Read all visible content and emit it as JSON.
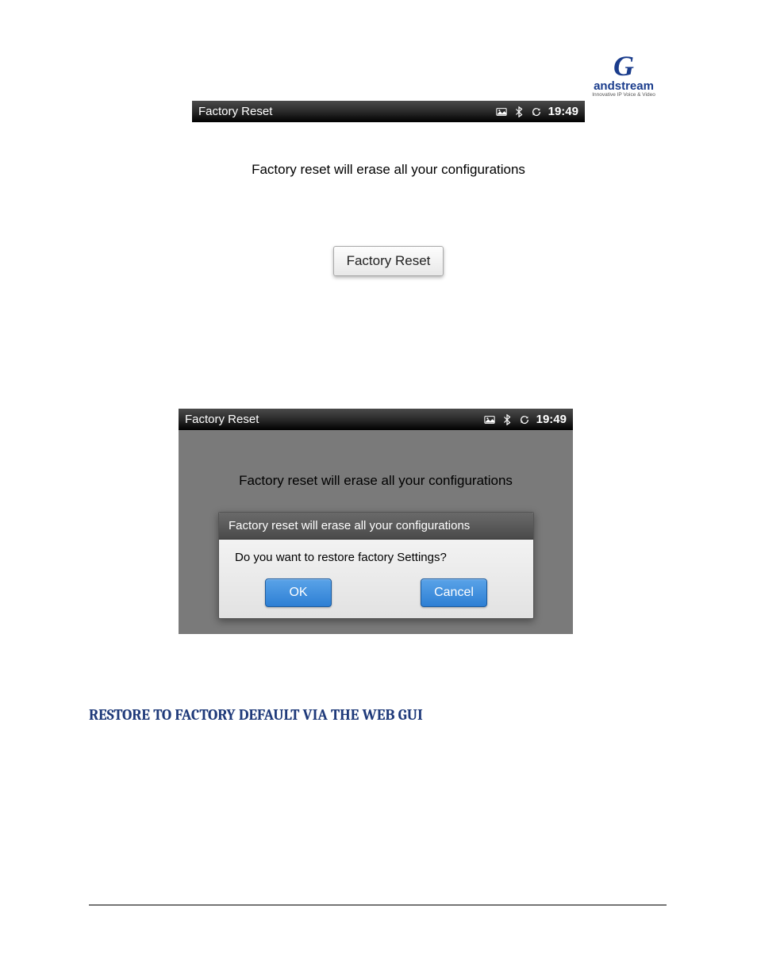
{
  "logo": {
    "brand": "Grandstream",
    "brand_g": "G",
    "brand_rest": "andstream",
    "tagline": "Innovative IP Voice & Video"
  },
  "screenshot1": {
    "statusbar": {
      "title": "Factory Reset",
      "time": "19:49",
      "icons": [
        "picture-icon",
        "bluetooth-icon",
        "sync-icon"
      ]
    },
    "warning_text": "Factory reset will erase all your configurations",
    "button_label": "Factory Reset"
  },
  "screenshot2": {
    "statusbar": {
      "title": "Factory Reset",
      "time": "19:49",
      "icons": [
        "picture-icon",
        "bluetooth-icon",
        "sync-icon"
      ]
    },
    "bg_warning_text": "Factory reset will erase all your configurations",
    "dialog": {
      "header": "Factory reset will erase all your configurations",
      "body": "Do you want to restore factory Settings?",
      "ok_label": "OK",
      "cancel_label": "Cancel"
    }
  },
  "section_heading": "RESTORE TO FACTORY DEFAULT VIA THE WEB GUI"
}
